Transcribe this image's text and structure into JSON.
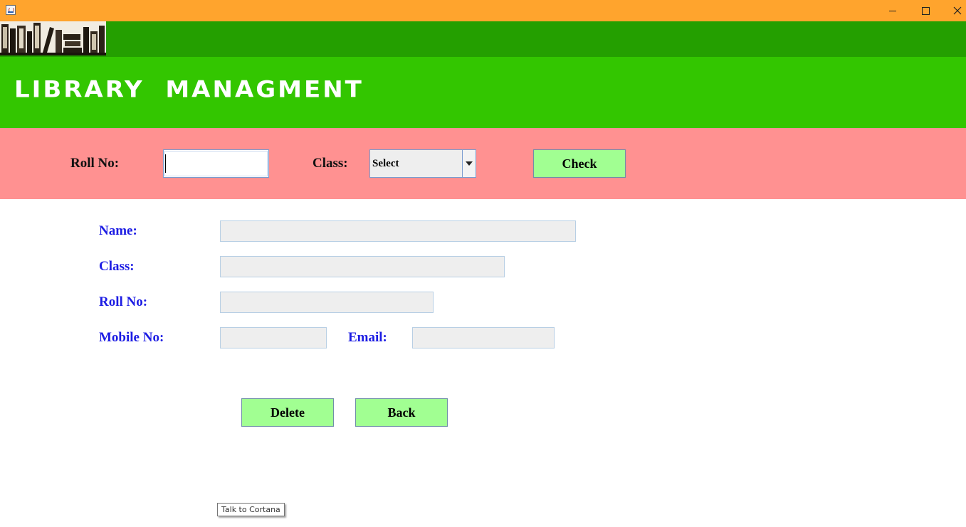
{
  "window": {
    "minimize_icon": "minimize-icon",
    "maximize_icon": "maximize-icon",
    "close_icon": "close-icon",
    "titlebar_color": "#ffa42d"
  },
  "header": {
    "logo_icon": "books-logo",
    "title": "LIBRARY  MANAGMENT",
    "title_color": "#ffffff",
    "banner_color": "#33c600"
  },
  "search": {
    "roll_label": "Roll No:",
    "roll_value": "",
    "class_label": "Class:",
    "class_selected": "Select",
    "check_label": "Check",
    "panel_color": "#ff9191"
  },
  "details": {
    "name_label": "Name:",
    "name_value": "",
    "class_label": "Class:",
    "class_value": "",
    "roll_label": "Roll No:",
    "roll_value": "",
    "mobile_label": "Mobile No:",
    "mobile_value": "",
    "email_label": "Email:",
    "email_value": "",
    "label_color": "#1c1ce3"
  },
  "actions": {
    "delete_label": "Delete",
    "back_label": "Back",
    "button_color": "#a1ff92"
  },
  "tooltip": {
    "text": "Talk to Cortana"
  }
}
